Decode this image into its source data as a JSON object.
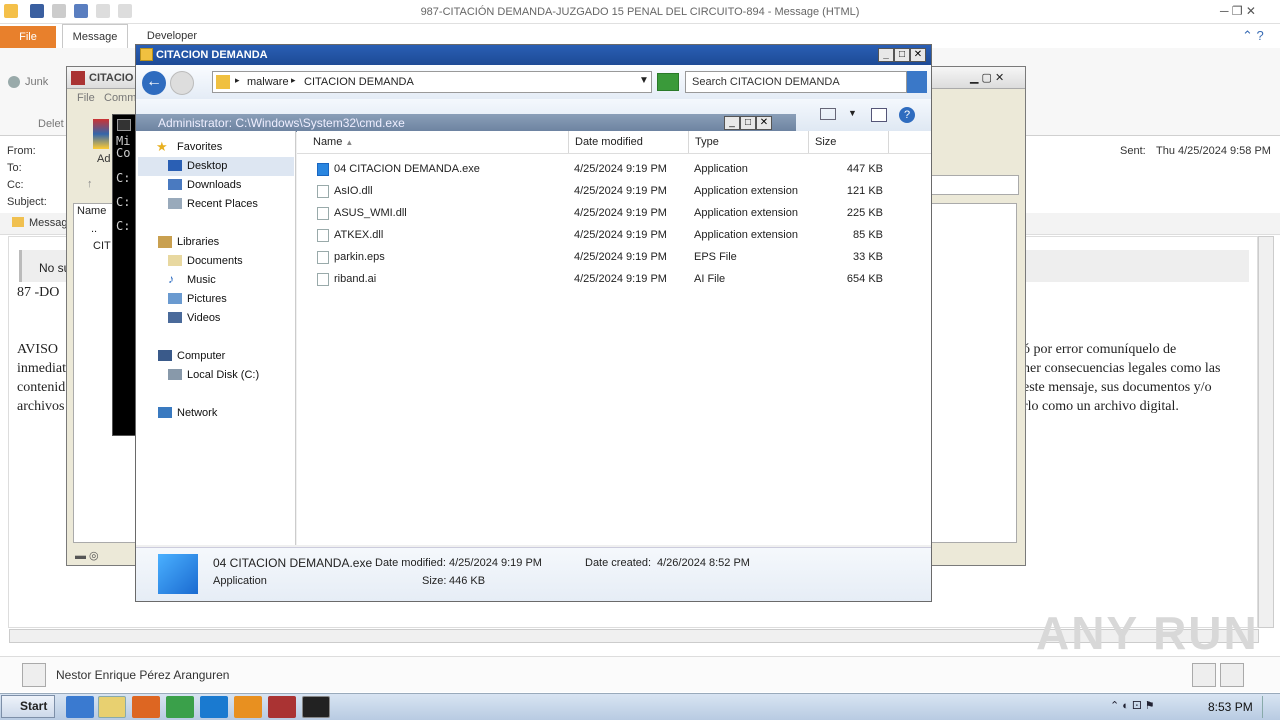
{
  "outlook": {
    "title": "987-CITACIÓN  DEMANDA-JUZGADO 15 PENAL DEL CIRCUITO-894 -  Message (HTML)",
    "tabs": {
      "file": "File",
      "message": "Message",
      "developer": "Developer"
    },
    "ribbon": {
      "junk": "Junk",
      "delete": "Delet"
    },
    "headers": {
      "from": "From:",
      "to": "To:",
      "cc": "Cc:",
      "subject": "Subject:",
      "sent_label": "Sent:",
      "sent_value": "Thu 4/25/2024 9:58 PM"
    },
    "message_tab": "Messag",
    "body": {
      "banner": "No su",
      "line1": "87 -DO",
      "aviso": "AVISO",
      "inmed": "inmediat",
      "contenido": "contenid",
      "archivos": "archivos",
      "right1": "ó por error comuníquelo de",
      "right2": "ner consecuencias legales como las",
      "right3": "este mensaje, sus documentos y/o",
      "right4": "rlo como un archivo digital."
    },
    "sender": "Nestor Enrique Pérez Aranguren"
  },
  "winrar": {
    "title": "CITACIO",
    "menu": {
      "file": "File",
      "commands": "Comm"
    },
    "add_label": "Ad",
    "col_name": "Name",
    "rows": [
      "..",
      "CIT"
    ]
  },
  "cmd": {
    "title": "Administrator: C:\\Windows\\System32\\cmd.exe",
    "lines": [
      "Mi",
      "Co",
      "C:",
      "C:",
      "C:"
    ]
  },
  "explorer": {
    "title": "CITACION DEMANDA",
    "breadcrumb": [
      "malware",
      "CITACION DEMANDA"
    ],
    "search_placeholder": "Search CITACION DEMANDA",
    "nav": {
      "favorites": "Favorites",
      "desktop": "Desktop",
      "downloads": "Downloads",
      "recent": "Recent Places",
      "libraries": "Libraries",
      "documents": "Documents",
      "music": "Music",
      "pictures": "Pictures",
      "videos": "Videos",
      "computer": "Computer",
      "local_disk": "Local Disk (C:)",
      "network": "Network"
    },
    "columns": {
      "name": "Name",
      "date": "Date modified",
      "type": "Type",
      "size": "Size"
    },
    "files": [
      {
        "name": "04 CITACION DEMANDA.exe",
        "date": "4/25/2024 9:19 PM",
        "type": "Application",
        "size": "447 KB"
      },
      {
        "name": "AsIO.dll",
        "date": "4/25/2024 9:19 PM",
        "type": "Application extension",
        "size": "121 KB"
      },
      {
        "name": "ASUS_WMI.dll",
        "date": "4/25/2024 9:19 PM",
        "type": "Application extension",
        "size": "225 KB"
      },
      {
        "name": "ATKEX.dll",
        "date": "4/25/2024 9:19 PM",
        "type": "Application extension",
        "size": "85 KB"
      },
      {
        "name": "parkin.eps",
        "date": "4/25/2024 9:19 PM",
        "type": "EPS File",
        "size": "33 KB"
      },
      {
        "name": "riband.ai",
        "date": "4/25/2024 9:19 PM",
        "type": "AI File",
        "size": "654 KB"
      }
    ],
    "details": {
      "name": "04 CITACION DEMANDA.exe",
      "kind": "Application",
      "modified_label": "Date modified:",
      "modified": "4/25/2024 9:19 PM",
      "created_label": "Date created:",
      "created": "4/26/2024 8:52 PM",
      "size_label": "Size:",
      "size": "446 KB"
    }
  },
  "taskbar": {
    "start": "Start",
    "clock": "8:53 PM"
  },
  "watermark": "ANY RUN",
  "colors": {
    "accent": "#e8802c",
    "title_blue": "#1d4a96"
  }
}
